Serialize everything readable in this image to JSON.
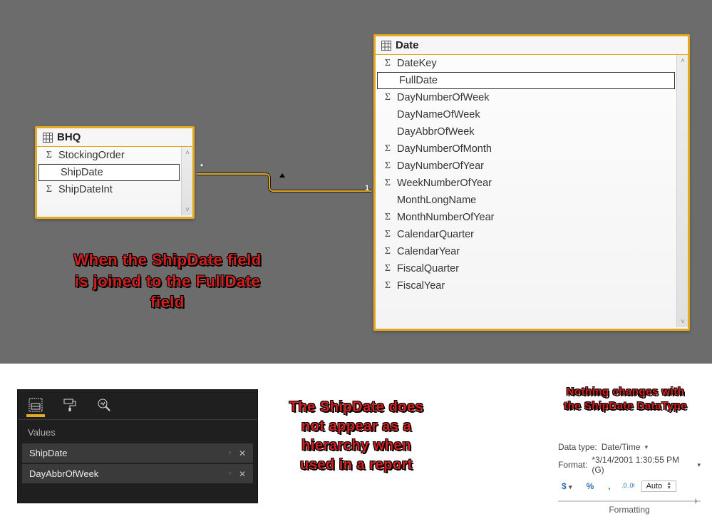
{
  "model": {
    "bhq": {
      "title": "BHQ",
      "fields": [
        {
          "name": "StockingOrder",
          "sigma": true,
          "selected": false
        },
        {
          "name": "ShipDate",
          "sigma": false,
          "selected": true
        },
        {
          "name": "ShipDateInt",
          "sigma": true,
          "selected": false
        }
      ]
    },
    "date": {
      "title": "Date",
      "fields": [
        {
          "name": "DateKey",
          "sigma": true,
          "selected": false
        },
        {
          "name": "FullDate",
          "sigma": false,
          "selected": true
        },
        {
          "name": "DayNumberOfWeek",
          "sigma": true,
          "selected": false
        },
        {
          "name": "DayNameOfWeek",
          "sigma": false,
          "selected": false
        },
        {
          "name": "DayAbbrOfWeek",
          "sigma": false,
          "selected": false
        },
        {
          "name": "DayNumberOfMonth",
          "sigma": true,
          "selected": false
        },
        {
          "name": "DayNumberOfYear",
          "sigma": true,
          "selected": false
        },
        {
          "name": "WeekNumberOfYear",
          "sigma": true,
          "selected": false
        },
        {
          "name": "MonthLongName",
          "sigma": false,
          "selected": false
        },
        {
          "name": "MonthNumberOfYear",
          "sigma": true,
          "selected": false
        },
        {
          "name": "CalendarQuarter",
          "sigma": true,
          "selected": false
        },
        {
          "name": "CalendarYear",
          "sigma": true,
          "selected": false
        },
        {
          "name": "FiscalQuarter",
          "sigma": true,
          "selected": false
        },
        {
          "name": "FiscalYear",
          "sigma": true,
          "selected": false
        }
      ]
    },
    "relationship": {
      "left_cardinality": "*",
      "right_cardinality": "1"
    }
  },
  "annotations": {
    "top": "When the ShipDate field\nis joined to the FullDate\nfield",
    "mid": "The ShipDate does\nnot appear as a\nhierarchy when\nused in a report",
    "right": "Nothing changes with\nthe ShipDate DataType"
  },
  "values_pane": {
    "section_label": "Values",
    "items": [
      "ShipDate",
      "DayAbbrOfWeek"
    ]
  },
  "formatting": {
    "data_type_label": "Data type:",
    "data_type_value": "Date/Time",
    "format_label": "Format:",
    "format_value": "*3/14/2001 1:30:55 PM (G)",
    "currency": "$",
    "percent": "%",
    "comma": ",",
    "auto": "Auto",
    "group": "Formatting"
  }
}
